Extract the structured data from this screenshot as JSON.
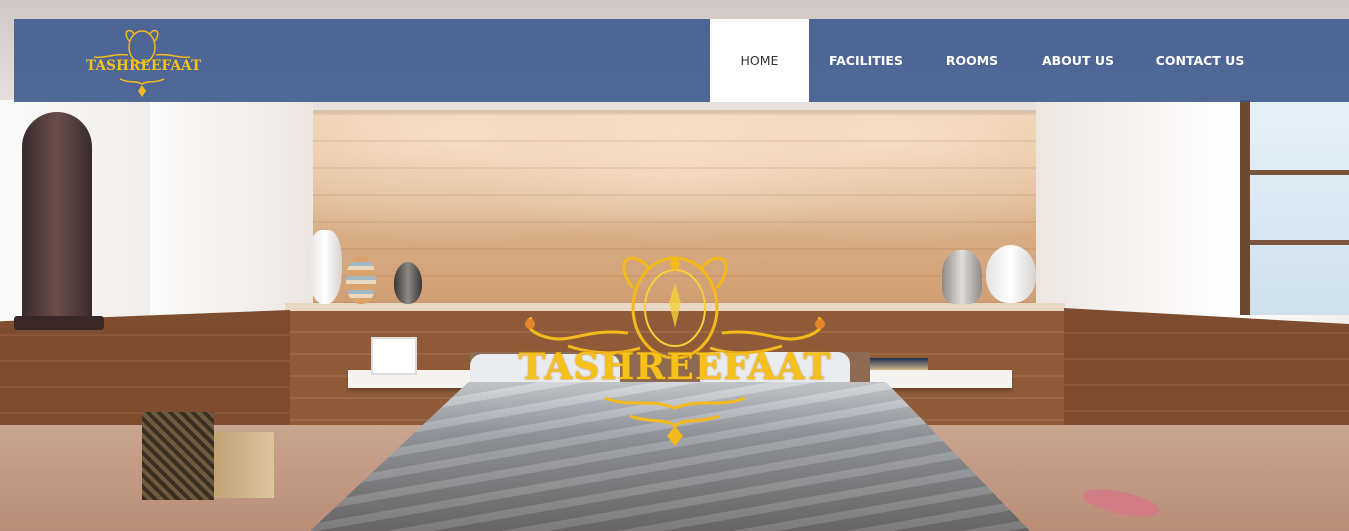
{
  "brand": {
    "name": "TASHREEFAAT",
    "logo_icon": "ornate-crest-icon",
    "color": "#f6c21a"
  },
  "nav": {
    "items": [
      {
        "label": "HOME",
        "active": true
      },
      {
        "label": "FACILITIES",
        "active": false
      },
      {
        "label": "ROOMS",
        "active": false
      },
      {
        "label": "ABOUT US",
        "active": false
      },
      {
        "label": "CONTACT US",
        "active": false
      }
    ],
    "bar_color": "#3a568c",
    "active_bg": "#ffffff"
  },
  "hero": {
    "logo_text": "TASHREEFAAT",
    "background": "bedroom-photo"
  }
}
